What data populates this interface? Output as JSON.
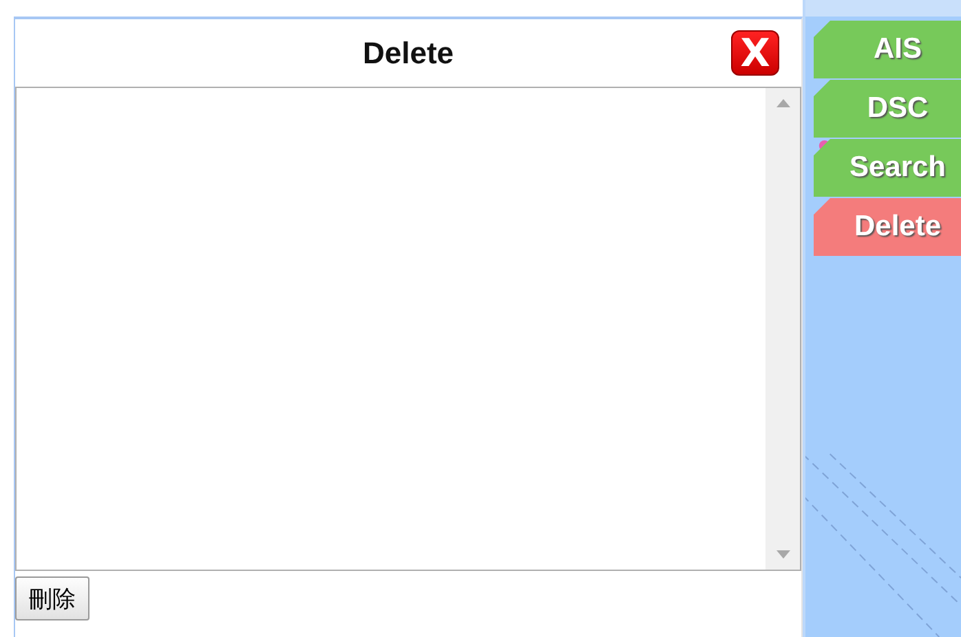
{
  "dialog": {
    "title": "Delete",
    "close_button": {
      "label": "X"
    },
    "action_button": {
      "label": "刪除"
    }
  },
  "side_tabs": [
    {
      "label": "AIS",
      "color": "#77c95a"
    },
    {
      "label": "DSC",
      "color": "#77c95a"
    },
    {
      "label": "Search",
      "color": "#77c95a"
    },
    {
      "label": "Delete",
      "color": "#f47c7c"
    }
  ]
}
